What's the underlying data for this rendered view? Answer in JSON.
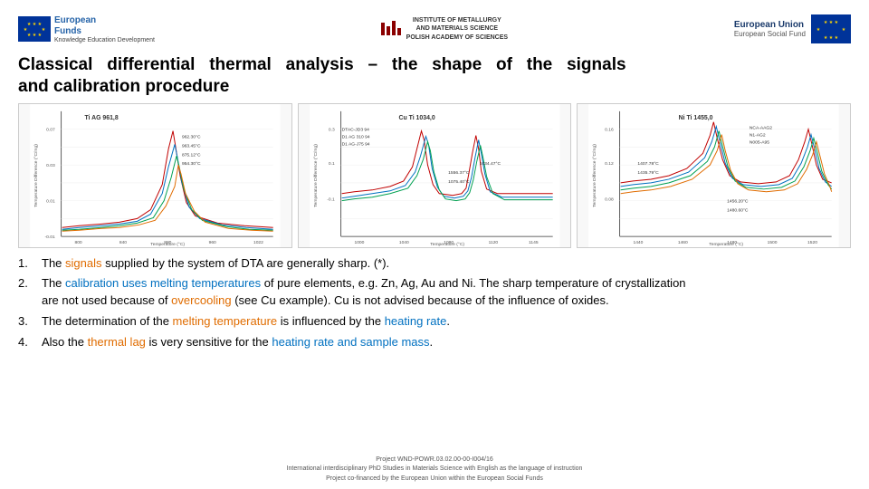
{
  "header": {
    "logo_left": {
      "fund_name": "European",
      "fund_name2": "Funds",
      "fund_sub": "Knowledge Education Development"
    },
    "logo_center": {
      "line1": "INSTITUTE OF METALLURGY",
      "line2": "AND MATERIALS SCIENCE",
      "line3": "POLISH ACADEMY OF SCIENCES"
    },
    "logo_right": {
      "main": "European Union",
      "sub": "European Social Fund"
    }
  },
  "title": {
    "line1": "Classical   differential   thermal   analysis  –   the   shape   of   the   signals",
    "line2": "and calibration procedure"
  },
  "charts": [
    {
      "label": "Ti AG 961,8",
      "subtitle": "Temperature (°C)"
    },
    {
      "label": "Cu Ti 1034,0",
      "subtitle": "Temperature (°C)"
    },
    {
      "label": "Ni Ti 1455,0",
      "subtitle": "Temperature (°C)"
    }
  ],
  "list_items": [
    {
      "num": "1.",
      "text_parts": [
        {
          "text": "The ",
          "style": "normal"
        },
        {
          "text": "signals",
          "style": "orange"
        },
        {
          "text": " supplied by the system of DTA are generally sharp. (*).",
          "style": "normal"
        }
      ]
    },
    {
      "num": "2.",
      "text_parts": [
        {
          "text": "The ",
          "style": "normal"
        },
        {
          "text": "calibration uses melting temperatures",
          "style": "blue"
        },
        {
          "text": " of pure elements, e.g. Zn, Ag, Au and Ni. The sharp temperature of crystallization",
          "style": "normal"
        }
      ],
      "line2_parts": [
        {
          "text": "are not used because of ",
          "style": "normal"
        },
        {
          "text": "overcooling",
          "style": "orange"
        },
        {
          "text": " (see Cu example). Cu is not advised because of the influence of oxides.",
          "style": "normal"
        }
      ]
    },
    {
      "num": "3.",
      "text_parts": [
        {
          "text": "The determination of the ",
          "style": "normal"
        },
        {
          "text": "melting temperature",
          "style": "orange"
        },
        {
          "text": " is influenced by the ",
          "style": "normal"
        },
        {
          "text": "heating rate",
          "style": "blue"
        },
        {
          "text": ".",
          "style": "normal"
        }
      ]
    },
    {
      "num": "4.",
      "text_parts": [
        {
          "text": "Also the ",
          "style": "normal"
        },
        {
          "text": "thermal lag",
          "style": "orange"
        },
        {
          "text": " is very sensitive for the ",
          "style": "normal"
        },
        {
          "text": "heating rate and sample mass",
          "style": "blue"
        },
        {
          "text": ".",
          "style": "normal"
        }
      ]
    }
  ],
  "footer": {
    "line1": "Project WND-POWR.03.02.00-00-I004/16",
    "line2": "International interdisciplinary PhD Studies in Materials Science with English as the language of instruction",
    "line3": "Project co-financed by the European Union within the European Social Funds"
  }
}
